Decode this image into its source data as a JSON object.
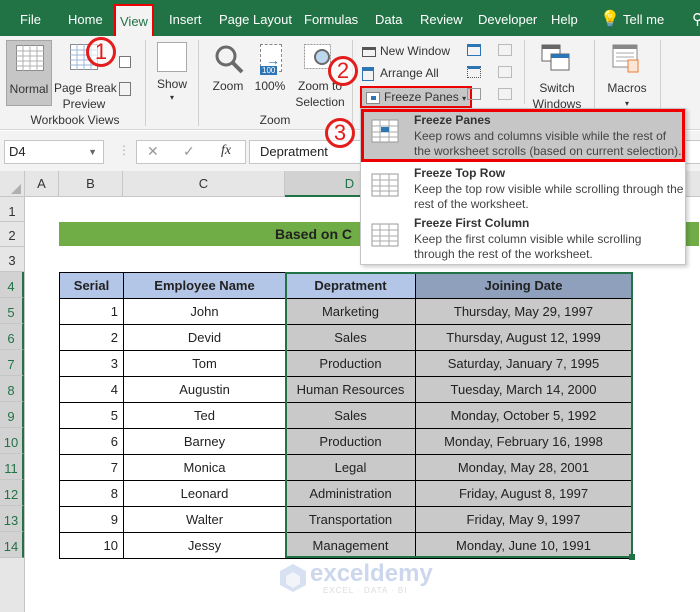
{
  "menu": {
    "tabs": [
      "File",
      "Home",
      "View",
      "Insert",
      "Page Layout",
      "Formulas",
      "Data",
      "Review",
      "Developer",
      "Help",
      "Tell me"
    ],
    "active_tab": "View"
  },
  "ribbon": {
    "workbook_views": {
      "normal": "Normal",
      "page_break_line1": "Page Break",
      "page_break_line2": "Preview",
      "group_label": "Workbook Views"
    },
    "show": {
      "label": "Show"
    },
    "zoom": {
      "zoom": "Zoom",
      "hundred": "100%",
      "badge": "100",
      "zoom_sel_line1": "Zoom to",
      "zoom_sel_line2": "Selection",
      "group_label": "Zoom"
    },
    "window": {
      "new_window": "New Window",
      "arrange_all": "Arrange All",
      "freeze_panes": "Freeze Panes",
      "switch_line1": "Switch",
      "switch_line2": "Windows"
    },
    "macros": {
      "label": "Macros"
    }
  },
  "callouts": [
    "1",
    "2",
    "3"
  ],
  "freeze_menu": [
    {
      "title": "Freeze Panes",
      "desc": "Keep rows and columns visible while the rest of the worksheet scrolls (based on current selection)."
    },
    {
      "title": "Freeze Top Row",
      "desc": "Keep the top row visible while scrolling through the rest of the worksheet."
    },
    {
      "title": "Freeze First Column",
      "desc": "Keep the first column visible while scrolling through the rest of the worksheet."
    }
  ],
  "formula_bar": {
    "name_box": "D4",
    "fx": "fx",
    "cancel": "✕",
    "enter": "✓",
    "content": "Depratment"
  },
  "columns": [
    "A",
    "B",
    "C",
    "D"
  ],
  "rows": [
    "1",
    "2",
    "3",
    "4",
    "5",
    "6",
    "7",
    "8",
    "9",
    "10",
    "11",
    "12",
    "13",
    "14"
  ],
  "sheet": {
    "title": "Based on C",
    "headers": [
      "Serial",
      "Employee Name",
      "Depratment",
      "Joining Date"
    ],
    "data": [
      [
        "1",
        "John",
        "Marketing",
        "Thursday, May 29, 1997"
      ],
      [
        "2",
        "Devid",
        "Sales",
        "Thursday, August 12, 1999"
      ],
      [
        "3",
        "Tom",
        "Production",
        "Saturday, January 7, 1995"
      ],
      [
        "4",
        "Augustin",
        "Human Resources",
        "Tuesday, March 14, 2000"
      ],
      [
        "5",
        "Ted",
        "Sales",
        "Monday, October 5, 1992"
      ],
      [
        "6",
        "Barney",
        "Production",
        "Monday, February 16, 1998"
      ],
      [
        "7",
        "Monica",
        "Legal",
        "Monday, May 28, 2001"
      ],
      [
        "8",
        "Leonard",
        "Administration",
        "Friday, August 8, 1997"
      ],
      [
        "9",
        "Walter",
        "Transportation",
        "Friday, May 9, 1997"
      ],
      [
        "10",
        "Jessy",
        "Management",
        "Monday, June 10, 1991"
      ]
    ]
  },
  "watermark": {
    "brand": "exceldemy",
    "tagline": "EXCEL · DATA · BI"
  }
}
